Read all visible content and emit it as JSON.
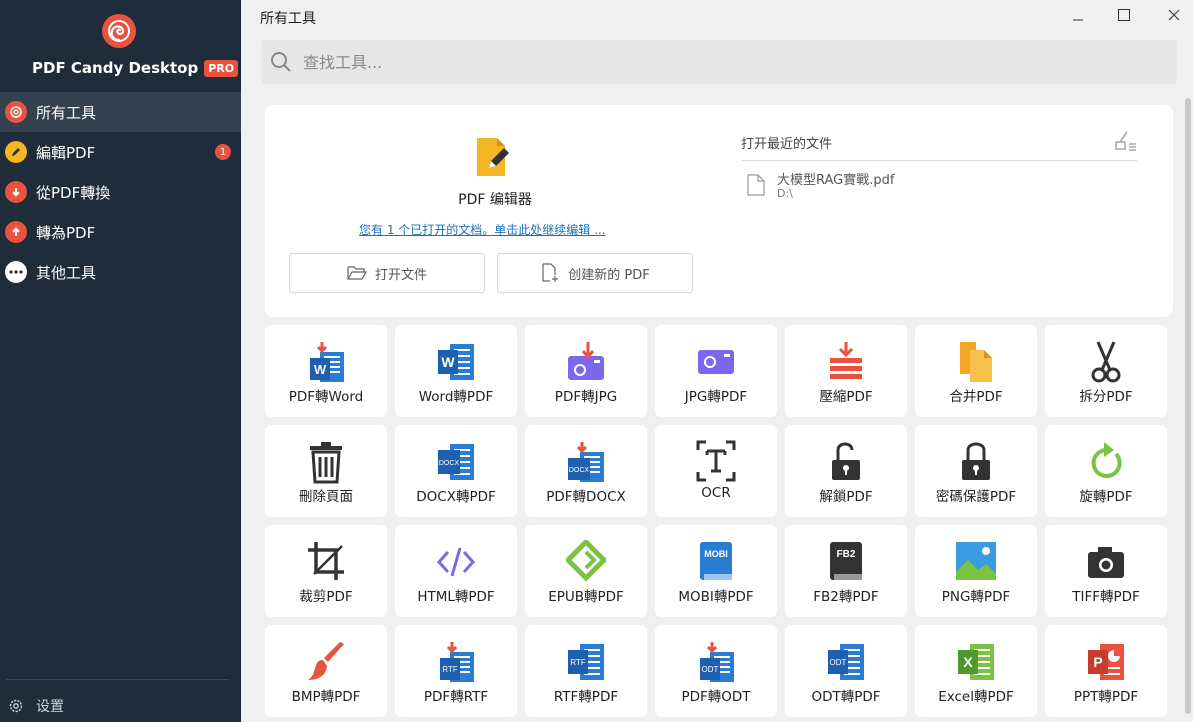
{
  "sidebar": {
    "app_name": "PDF Candy Desktop",
    "pro_badge": "PRO",
    "items": [
      {
        "label": "所有工具"
      },
      {
        "label": "編輯PDF",
        "badge": "1"
      },
      {
        "label": "從PDF轉換"
      },
      {
        "label": "轉為PDF"
      },
      {
        "label": "其他工具"
      }
    ],
    "settings_label": "设置"
  },
  "header": {
    "title": "所有工具",
    "search_placeholder": "查找工具..."
  },
  "editor": {
    "label": "PDF 编辑器",
    "link": "您有 1 个已打开的文档。单击此处继续编辑 ...",
    "open_button": "打开文件",
    "create_button": "创建新的 PDF"
  },
  "recent": {
    "title": "打开最近的文件",
    "items": [
      {
        "name": "大模型RAG實戰.pdf",
        "path": "D:\\"
      }
    ]
  },
  "tools": [
    {
      "label": "PDF轉Word",
      "icon": "pdf-to-word-icon"
    },
    {
      "label": "Word轉PDF",
      "icon": "word-to-pdf-icon"
    },
    {
      "label": "PDF轉JPG",
      "icon": "pdf-to-jpg-icon"
    },
    {
      "label": "JPG轉PDF",
      "icon": "jpg-to-pdf-icon"
    },
    {
      "label": "壓縮PDF",
      "icon": "compress-icon"
    },
    {
      "label": "合并PDF",
      "icon": "merge-icon"
    },
    {
      "label": "拆分PDF",
      "icon": "scissors-icon"
    },
    {
      "label": "刪除頁面",
      "icon": "trash-icon"
    },
    {
      "label": "DOCX轉PDF",
      "icon": "docx-to-pdf-icon"
    },
    {
      "label": "PDF轉DOCX",
      "icon": "pdf-to-docx-icon"
    },
    {
      "label": "OCR",
      "icon": "ocr-icon"
    },
    {
      "label": "解鎖PDF",
      "icon": "unlock-icon"
    },
    {
      "label": "密碼保護PDF",
      "icon": "lock-icon"
    },
    {
      "label": "旋轉PDF",
      "icon": "rotate-icon"
    },
    {
      "label": "裁剪PDF",
      "icon": "crop-icon"
    },
    {
      "label": "HTML轉PDF",
      "icon": "html-icon"
    },
    {
      "label": "EPUB轉PDF",
      "icon": "epub-icon"
    },
    {
      "label": "MOBI轉PDF",
      "icon": "mobi-icon"
    },
    {
      "label": "FB2轉PDF",
      "icon": "fb2-icon"
    },
    {
      "label": "PNG轉PDF",
      "icon": "png-icon"
    },
    {
      "label": "TIFF轉PDF",
      "icon": "camera-icon"
    },
    {
      "label": "BMP轉PDF",
      "icon": "brush-icon"
    },
    {
      "label": "PDF轉RTF",
      "icon": "pdf-to-rtf-icon"
    },
    {
      "label": "RTF轉PDF",
      "icon": "rtf-to-pdf-icon"
    },
    {
      "label": "PDF轉ODT",
      "icon": "pdf-to-odt-icon"
    },
    {
      "label": "ODT轉PDF",
      "icon": "odt-to-pdf-icon"
    },
    {
      "label": "Excel轉PDF",
      "icon": "excel-icon"
    },
    {
      "label": "PPT轉PDF",
      "icon": "ppt-icon"
    }
  ],
  "colors": {
    "sidebar_bg": "#1f2d3a",
    "accent": "#e8523f",
    "word_blue": "#2b7cd3",
    "green": "#7cc242",
    "orange": "#f5a623"
  }
}
